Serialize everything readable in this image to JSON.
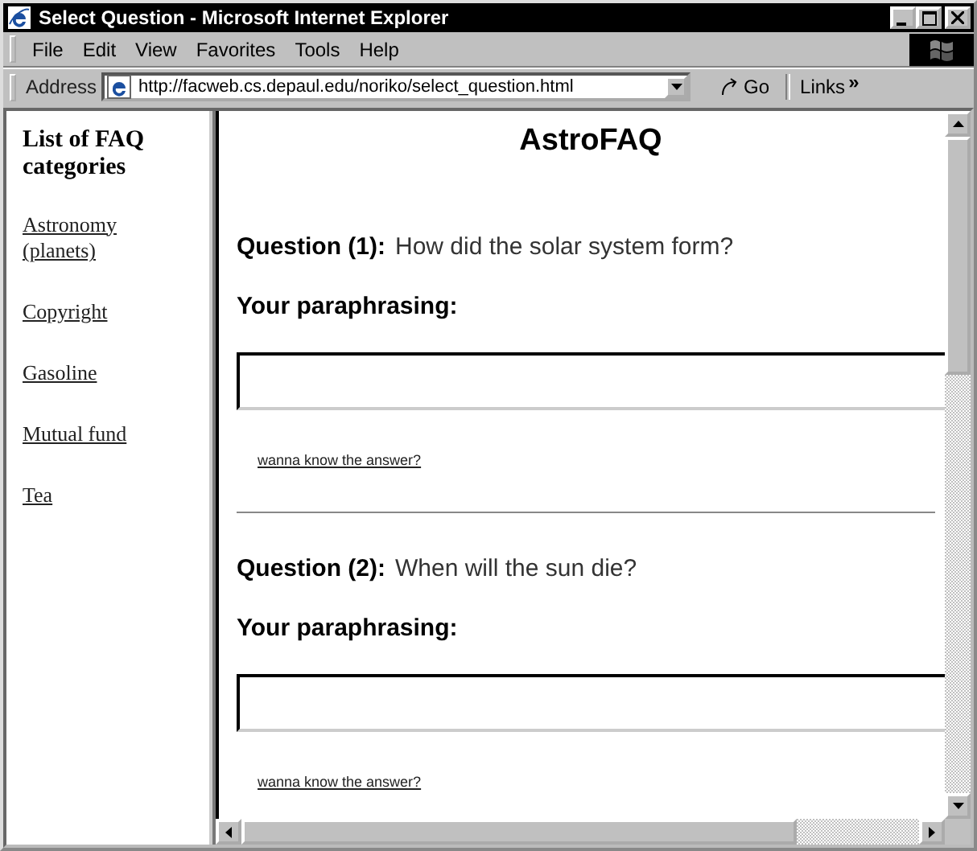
{
  "window": {
    "title": "Select Question - Microsoft Internet Explorer"
  },
  "menu": [
    {
      "label": "File"
    },
    {
      "label": "Edit"
    },
    {
      "label": "View"
    },
    {
      "label": "Favorites"
    },
    {
      "label": "Tools"
    },
    {
      "label": "Help"
    }
  ],
  "address_bar": {
    "label": "Address",
    "value": "http://facweb.cs.depaul.edu/noriko/select_question.html",
    "go": "Go",
    "links": "Links",
    "more": "»"
  },
  "sidebar": {
    "heading": "List of FAQ categories",
    "items": [
      "Astronomy (planets)",
      "Copyright",
      "Gasoline",
      "Mutual fund",
      "Tea"
    ]
  },
  "page": {
    "title": "AstroFAQ",
    "questions": [
      {
        "label": "Question (1):",
        "text": "How did the solar system form?",
        "prompt": "Your paraphrasing:",
        "link": "wanna know the answer?"
      },
      {
        "label": "Question (2):",
        "text": "When will the sun die?",
        "prompt": "Your paraphrasing:",
        "link": "wanna know the answer?"
      }
    ]
  }
}
